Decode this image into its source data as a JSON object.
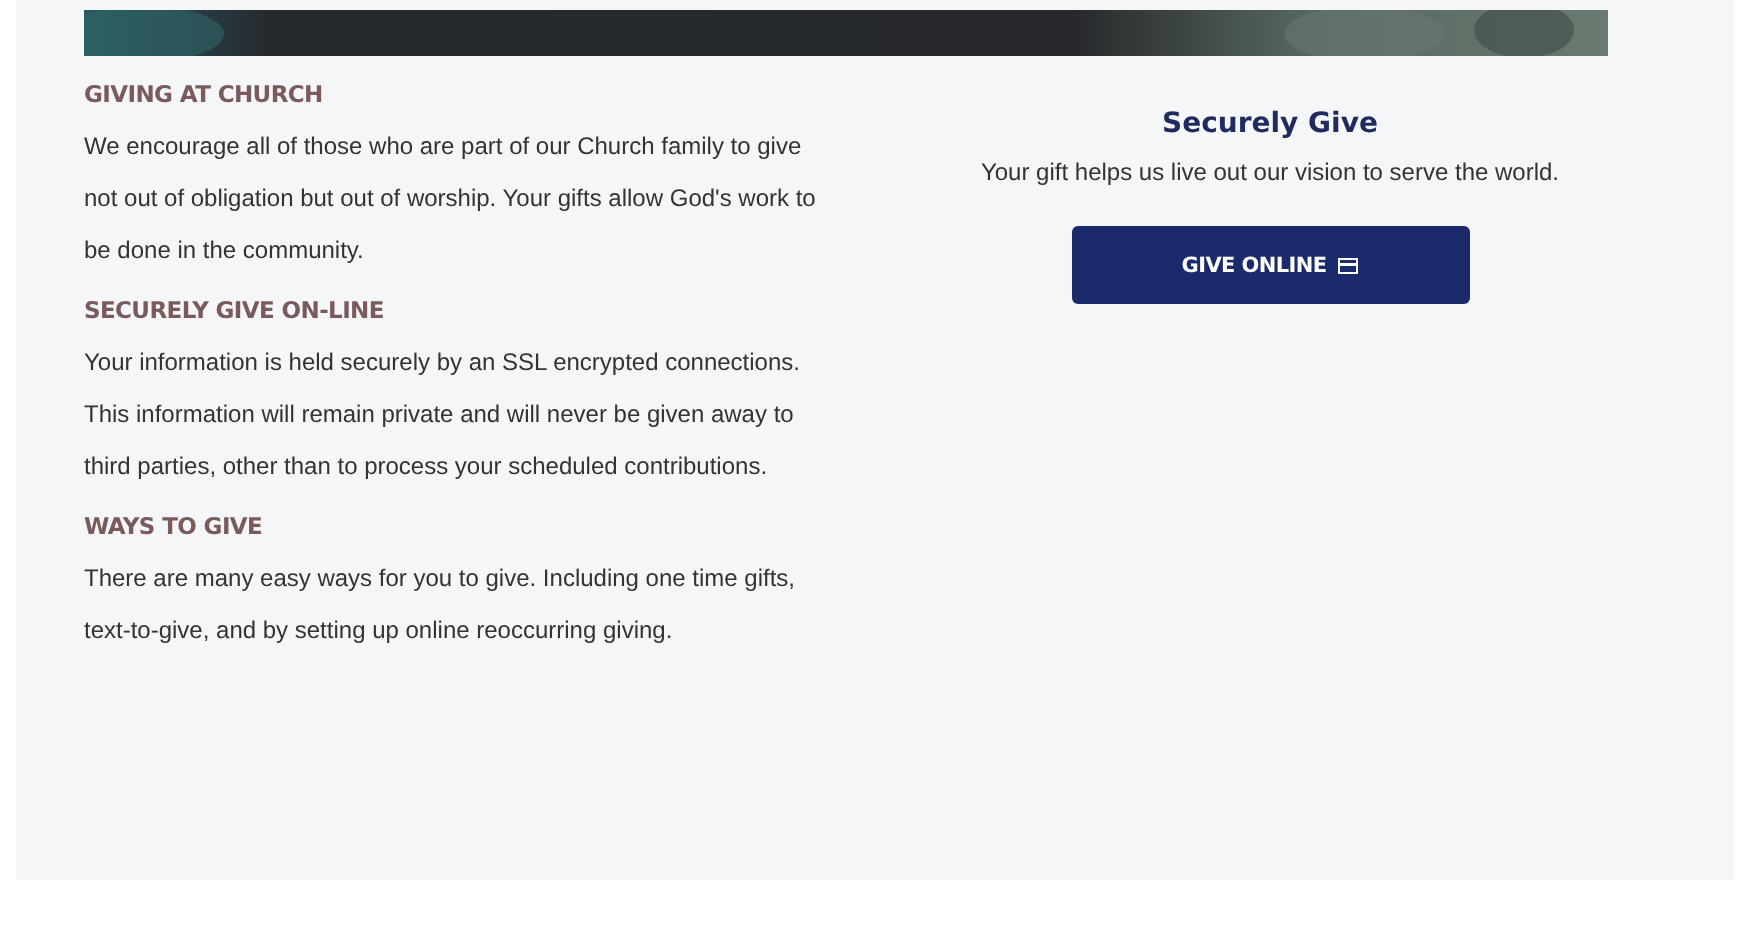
{
  "sections": [
    {
      "heading": "GIVING AT CHURCH",
      "body": "We encourage all of those who are part of our Church family to give not out of obligation but out of worship. Your gifts allow God's work to be done in the community."
    },
    {
      "heading": "SECURELY GIVE ON-LINE",
      "body": "Your information is held securely by an SSL encrypted connections. This information will remain private and will never be given away to third parties, other than to process your scheduled contributions."
    },
    {
      "heading": "WAYS TO GIVE",
      "body": "There are many easy ways for you to give. Including one time gifts, text-to-give, and by setting up online reoccurring giving."
    }
  ],
  "give": {
    "title": "Securely Give",
    "subtitle": "Your gift helps us live out our vision to serve the world.",
    "button": "GIVE ONLINE"
  }
}
